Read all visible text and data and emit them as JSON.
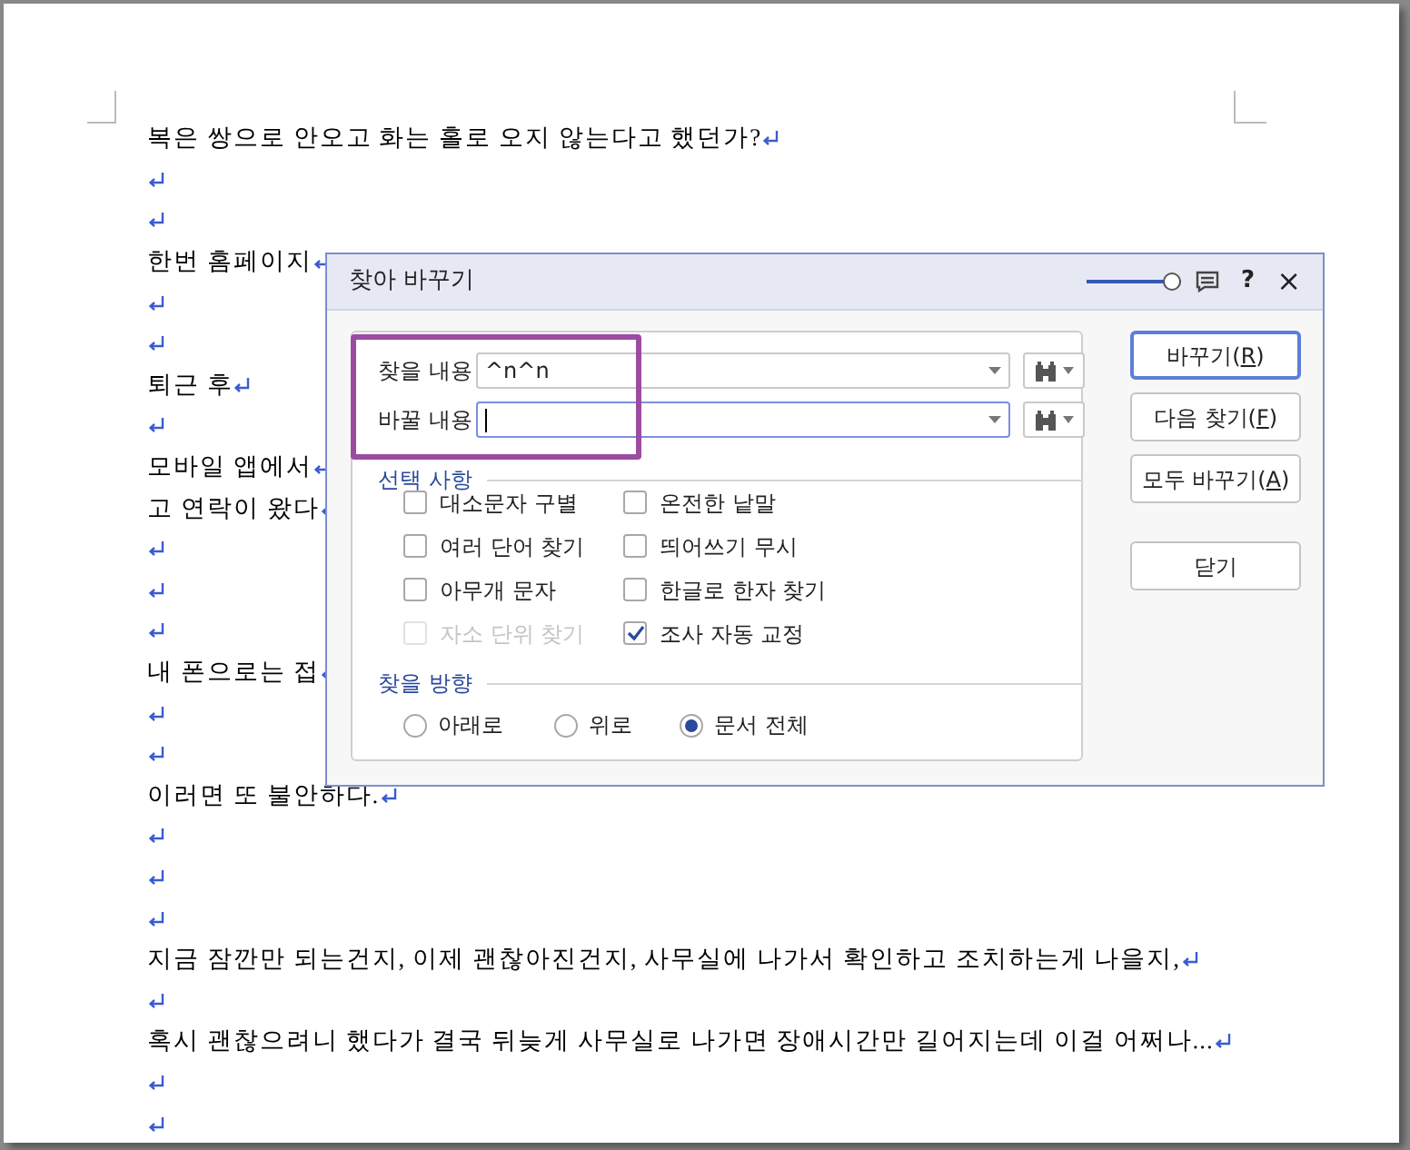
{
  "document": {
    "lines": [
      {
        "kind": "text",
        "text": "복은 쌍으로 안오고 화는 홀로 오지 않는다고 했던가?"
      },
      {
        "kind": "blank"
      },
      {
        "kind": "blank"
      },
      {
        "kind": "text",
        "text": "한번 홈페이지"
      },
      {
        "kind": "blank"
      },
      {
        "kind": "blank"
      },
      {
        "kind": "text",
        "text": "퇴근 후 "
      },
      {
        "kind": "blank"
      },
      {
        "kind": "text",
        "text": "모바일 앱에서"
      },
      {
        "kind": "text",
        "text": "고 연락이 왔다"
      },
      {
        "kind": "blank"
      },
      {
        "kind": "blank"
      },
      {
        "kind": "blank"
      },
      {
        "kind": "text",
        "text": "내 폰으로는 접"
      },
      {
        "kind": "blank"
      },
      {
        "kind": "blank"
      },
      {
        "kind": "text",
        "text": "이러면 또 불안하다. "
      },
      {
        "kind": "blank"
      },
      {
        "kind": "blank"
      },
      {
        "kind": "blank"
      },
      {
        "kind": "text",
        "text": "지금 잠깐만 되는건지, 이제 괜찮아진건지, 사무실에 나가서 확인하고 조치하는게 나을지, "
      },
      {
        "kind": "blank"
      },
      {
        "kind": "text",
        "text": "혹시 괜찮으려니 했다가 결국 뒤늦게 사무실로 나가면 장애시간만 길어지는데 이걸 어쩌나... "
      },
      {
        "kind": "blank"
      },
      {
        "kind": "blank"
      }
    ]
  },
  "dialog": {
    "title": "찾아 바꾸기",
    "opacity_slider": {
      "level": 1
    },
    "help": "?",
    "close": "×",
    "fields": [
      {
        "label": "찾을 내용",
        "value": "^n^n",
        "focused": false
      },
      {
        "label": "바꿀 내용",
        "focused": true
      }
    ],
    "options_title": "선택 사항",
    "options": [
      {
        "label": "대소문자 구별",
        "checked": false,
        "disabled": false
      },
      {
        "label": "온전한 낱말",
        "checked": false,
        "disabled": false
      },
      {
        "label": "여러 단어 찾기",
        "checked": false,
        "disabled": false
      },
      {
        "label": "띄어쓰기 무시",
        "checked": false,
        "disabled": false
      },
      {
        "label": "아무개 문자",
        "checked": false,
        "disabled": false
      },
      {
        "label": "한글로 한자 찾기",
        "checked": false,
        "disabled": false
      },
      {
        "label": "자소 단위 찾기",
        "checked": false,
        "disabled": true
      },
      {
        "label": "조사 자동 교정",
        "checked": true,
        "disabled": false
      }
    ],
    "direction_title": "찾을 방향",
    "directions": [
      {
        "label": "아래로",
        "selected": false
      },
      {
        "label": "위로",
        "selected": false
      },
      {
        "label": "문서 전체",
        "selected": true
      }
    ],
    "buttons": [
      {
        "before": "바꾸기(",
        "key": "R",
        "after": ")",
        "default": true
      },
      {
        "before": "다음 찾기(",
        "key": "F",
        "after": ")",
        "default": false
      },
      {
        "before": "모두 바꾸기(",
        "key": "A",
        "after": ")",
        "default": false
      },
      {
        "before": "닫기",
        "default": false
      }
    ]
  }
}
